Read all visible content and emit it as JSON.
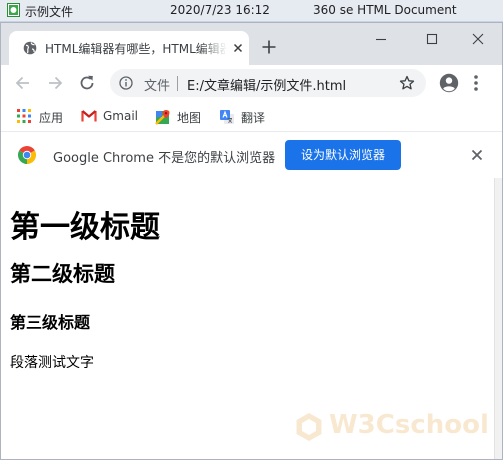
{
  "file_row": {
    "name": "示例文件",
    "date": "2020/7/23 16:12",
    "type": "360 se HTML Document"
  },
  "tab": {
    "title": "HTML编辑器有哪些，HTML编辑器"
  },
  "omnibox": {
    "scheme_label": "文件",
    "url": "E:/文章编辑/示例文件.html"
  },
  "bookmarks": [
    {
      "label": "应用",
      "icon": "apps-grid-icon"
    },
    {
      "label": "Gmail",
      "icon": "gmail-icon"
    },
    {
      "label": "地图",
      "icon": "maps-icon"
    },
    {
      "label": "翻译",
      "icon": "translate-icon"
    }
  ],
  "infobar": {
    "message": "Google Chrome 不是您的默认浏览器",
    "button_label": "设为默认浏览器"
  },
  "page": {
    "h1": "第一级标题",
    "h2": "第二级标题",
    "h3": "第三级标题",
    "paragraph": "段落测试文字"
  },
  "watermark": {
    "text": "W3Cschool"
  },
  "colors": {
    "tabstrip": "#dee1e6",
    "omnibox": "#f1f3f4",
    "accent_button": "#1a73e8",
    "watermark": "#e8992f"
  }
}
